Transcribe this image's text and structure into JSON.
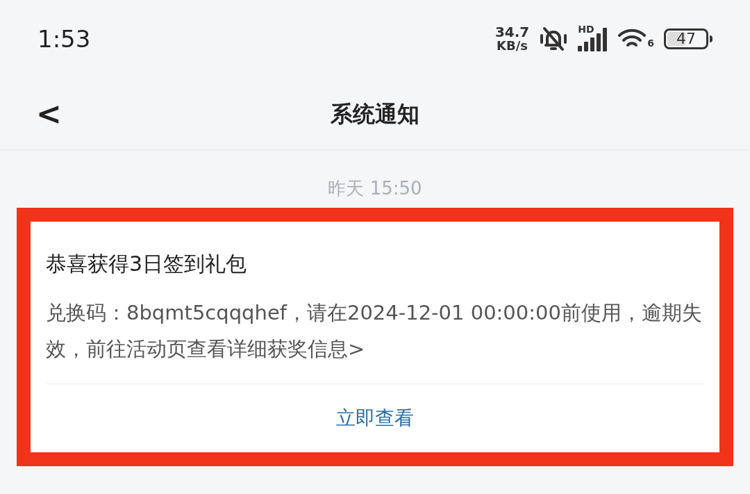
{
  "status_bar": {
    "time": "1:53",
    "speed_value": "34.7",
    "speed_unit": "KB/s",
    "network_label": "HD",
    "wifi_label": "6",
    "battery": "47"
  },
  "header": {
    "back": "<",
    "title": "系统通知"
  },
  "messages": [
    {
      "time": "昨天  15:50",
      "title": "恭喜获得3日签到礼包",
      "body": "兑换码：8bqmt5cqqqhef，请在2024-12-01 00:00:00前使用，逾期失效，前往活动页查看详细获奖信息>",
      "action": "立即查看",
      "highlighted": true
    }
  ]
}
